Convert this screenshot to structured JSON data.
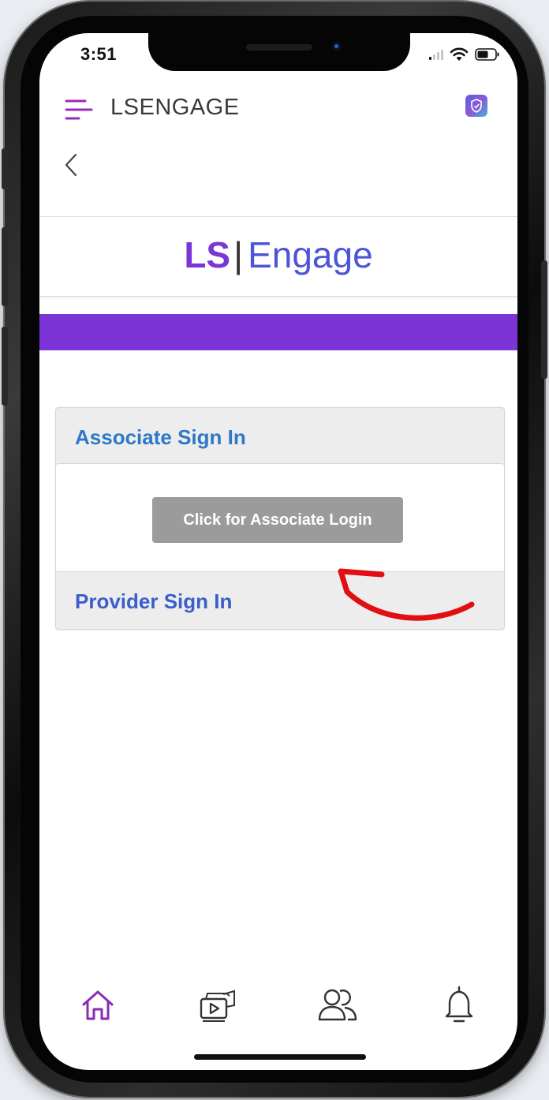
{
  "status_bar": {
    "time": "3:51",
    "icons": [
      "signal-icon",
      "wifi-icon",
      "battery-icon"
    ]
  },
  "header": {
    "title": "LSENGAGE",
    "menu_icon": "menu-icon",
    "profile_icon": "shield-icon",
    "back_icon": "chevron-left-icon"
  },
  "logo": {
    "part1": "LS",
    "separator": "|",
    "part2": "Engage"
  },
  "signin": {
    "associate_heading": "Associate Sign In",
    "associate_button": "Click for Associate Login",
    "provider_heading": "Provider Sign In"
  },
  "tabs": [
    {
      "name": "home",
      "icon": "home-icon",
      "active": true
    },
    {
      "name": "media",
      "icon": "media-icon",
      "active": false
    },
    {
      "name": "people",
      "icon": "people-icon",
      "active": false
    },
    {
      "name": "notifications",
      "icon": "bell-icon",
      "active": false
    }
  ],
  "colors": {
    "brand_purple": "#7b35d7",
    "logo_blue": "#4b55d6",
    "associate_blue": "#2f78c8",
    "provider_blue": "#3c5dcc",
    "button_gray": "#9b9b9b",
    "arrow_red": "#e10f14",
    "active_tab": "#8a2bb3"
  }
}
